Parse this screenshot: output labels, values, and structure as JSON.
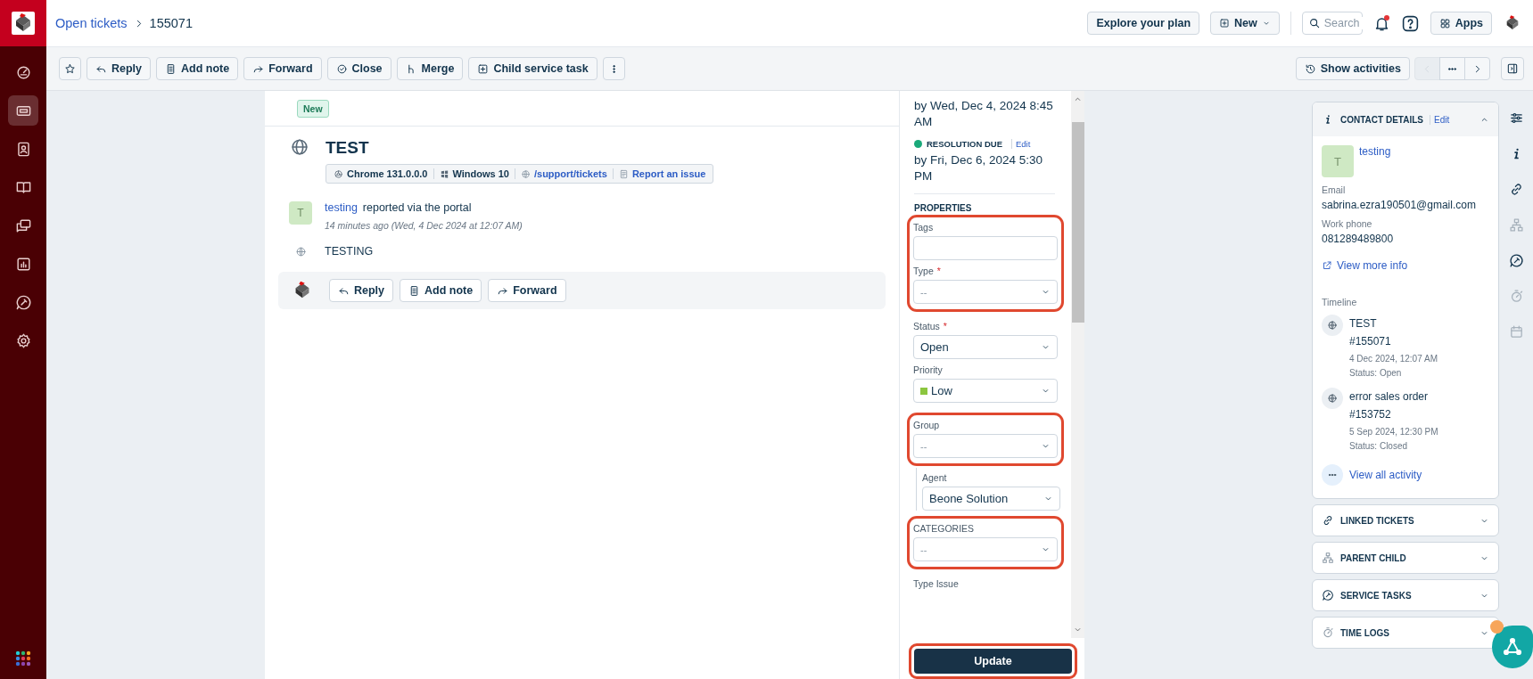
{
  "sidebar": {
    "items": [
      {
        "kind": "dashboard",
        "selected": false
      },
      {
        "kind": "ticket",
        "selected": true
      },
      {
        "kind": "contact",
        "selected": false
      },
      {
        "kind": "book",
        "selected": false
      },
      {
        "kind": "chat",
        "selected": false
      },
      {
        "kind": "report",
        "selected": false
      },
      {
        "kind": "service",
        "selected": false
      },
      {
        "kind": "gear",
        "selected": false
      }
    ]
  },
  "breadcrumb": {
    "link": "Open tickets",
    "current": "155071"
  },
  "header": {
    "plan_button": "Explore your plan",
    "new_button": "New",
    "search_placeholder": "Search",
    "notification_unread": true,
    "apps_button": "Apps"
  },
  "toolbar": {
    "buttons": [
      {
        "kind": "star"
      },
      {
        "kind": "reply",
        "label": "Reply"
      },
      {
        "kind": "note",
        "label": "Add note"
      },
      {
        "kind": "forward",
        "label": "Forward"
      },
      {
        "kind": "close",
        "label": "Close"
      },
      {
        "kind": "merge",
        "label": "Merge"
      },
      {
        "kind": "task",
        "label": "Child service task"
      },
      {
        "kind": "more"
      }
    ],
    "activities_button": "Show activities",
    "pager": [
      {
        "kind": "prev",
        "disabled": true
      },
      {
        "kind": "more",
        "disabled": false
      },
      {
        "kind": "next",
        "disabled": false
      }
    ]
  },
  "ticket": {
    "status_badge": "New",
    "subject": "TEST",
    "meta": [
      {
        "kind": "browser",
        "label": "Chrome 131.0.0.0",
        "link": false
      },
      {
        "kind": "os",
        "label": "Windows 10",
        "link": false
      },
      {
        "kind": "url",
        "label": "/support/tickets",
        "link": true
      },
      {
        "kind": "report",
        "label": "Report an issue",
        "link": true
      }
    ],
    "activity": {
      "avatar": "T",
      "author": "testing",
      "text": "reported via the portal",
      "time": "14 minutes ago (Wed, 4 Dec 2024 at 12:07 AM)"
    },
    "body": "TESTING",
    "reply_buttons": [
      {
        "kind": "reply",
        "label": "Reply"
      },
      {
        "kind": "note",
        "label": "Add note"
      },
      {
        "kind": "forward",
        "label": "Forward"
      }
    ]
  },
  "sla": {
    "first_response_due": "by Wed, Dec 4, 2024 8:45 AM",
    "resolution": {
      "label": "RESOLUTION DUE",
      "edit": "Edit",
      "due": "by Fri, Dec 6, 2024 5:30 PM",
      "color": "#1aa97a"
    }
  },
  "properties": {
    "heading": "PROPERTIES",
    "sections": [
      {
        "highlighted": true,
        "indented": false,
        "fields": [
          {
            "label": "Tags",
            "kind": "text"
          },
          {
            "label": "Type",
            "required_mark": "*",
            "kind": "select",
            "placeholder": "--"
          }
        ]
      },
      {
        "highlighted": false,
        "indented": false,
        "fields": [
          {
            "label": "Status",
            "required_mark": "*",
            "kind": "select",
            "value": "Open"
          },
          {
            "label": "Priority",
            "kind": "select",
            "value": "Low",
            "color": "#8cc63f"
          }
        ]
      },
      {
        "highlighted": true,
        "indented": false,
        "fields": [
          {
            "label": "Group",
            "kind": "select",
            "placeholder": "--"
          }
        ]
      },
      {
        "highlighted": false,
        "indented": true,
        "fields": [
          {
            "label": "Agent",
            "kind": "select",
            "value": "Beone Solution"
          }
        ]
      },
      {
        "highlighted": true,
        "indented": false,
        "fields": [
          {
            "label": "CATEGORIES",
            "kind": "select",
            "placeholder": "--"
          }
        ]
      },
      {
        "highlighted": false,
        "indented": false,
        "fields": [
          {
            "label": "Type Issue",
            "kind": "label"
          }
        ]
      }
    ],
    "update_button": {
      "label": "Update",
      "highlighted": true
    }
  },
  "contact": {
    "heading": "CONTACT DETAILS",
    "edit": "Edit",
    "expanded": true,
    "avatar": "T",
    "name": "testing",
    "fields": [
      {
        "label": "Email",
        "value": "sabrina.ezra190501@gmail.com"
      },
      {
        "label": "Work phone",
        "value": "081289489800"
      }
    ],
    "more_link": "View more info",
    "timeline_label": "Timeline",
    "timeline": [
      {
        "title": "TEST",
        "number": "#155071",
        "date": "4 Dec 2024, 12:07 AM",
        "status": "Status: Open"
      },
      {
        "title": "error sales order",
        "number": "#153752",
        "date": "5 Sep 2024, 12:30 PM",
        "status": "Status: Closed"
      }
    ],
    "view_all": "View all activity"
  },
  "panels": [
    {
      "kind": "link",
      "title": "LINKED TICKETS",
      "expanded": false
    },
    {
      "kind": "hierarchy",
      "title": "PARENT CHILD",
      "expanded": false
    },
    {
      "kind": "service",
      "title": "SERVICE TASKS",
      "expanded": false
    },
    {
      "kind": "timer",
      "title": "TIME LOGS",
      "expanded": false
    }
  ],
  "rail": [
    {
      "kind": "filters",
      "disabled": false
    },
    {
      "kind": "info",
      "disabled": false
    },
    {
      "kind": "link",
      "disabled": false
    },
    {
      "kind": "hierarchy",
      "disabled": true
    },
    {
      "kind": "service",
      "disabled": false
    },
    {
      "kind": "timer",
      "disabled": true
    },
    {
      "kind": "calendar",
      "disabled": true
    }
  ],
  "assistant": {
    "badge": true
  }
}
